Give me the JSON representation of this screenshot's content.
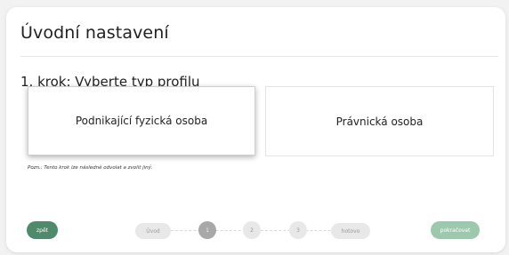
{
  "header": {
    "title": "Úvodní nastavení"
  },
  "step": {
    "heading": "1. krok: Vyberte typ profilu",
    "options": [
      {
        "label": "Podnikající fyzická osoba",
        "selected": true
      },
      {
        "label": "Právnická osoba",
        "selected": false
      }
    ],
    "note": "Pozn.: Tento krok lze následně odvolat a zvolit jiný."
  },
  "footer": {
    "back_label": "zpět",
    "next_label": "pokračovat",
    "stepper": {
      "start_label": "Úvod",
      "steps": [
        "1",
        "2",
        "3"
      ],
      "active_index": 0,
      "end_label": "hotovo"
    }
  },
  "colors": {
    "back_button": "#4f8a6a",
    "next_button_disabled": "#9cc9ad",
    "active_step": "#a8a8a8",
    "inactive_step": "#e8e8e8"
  }
}
